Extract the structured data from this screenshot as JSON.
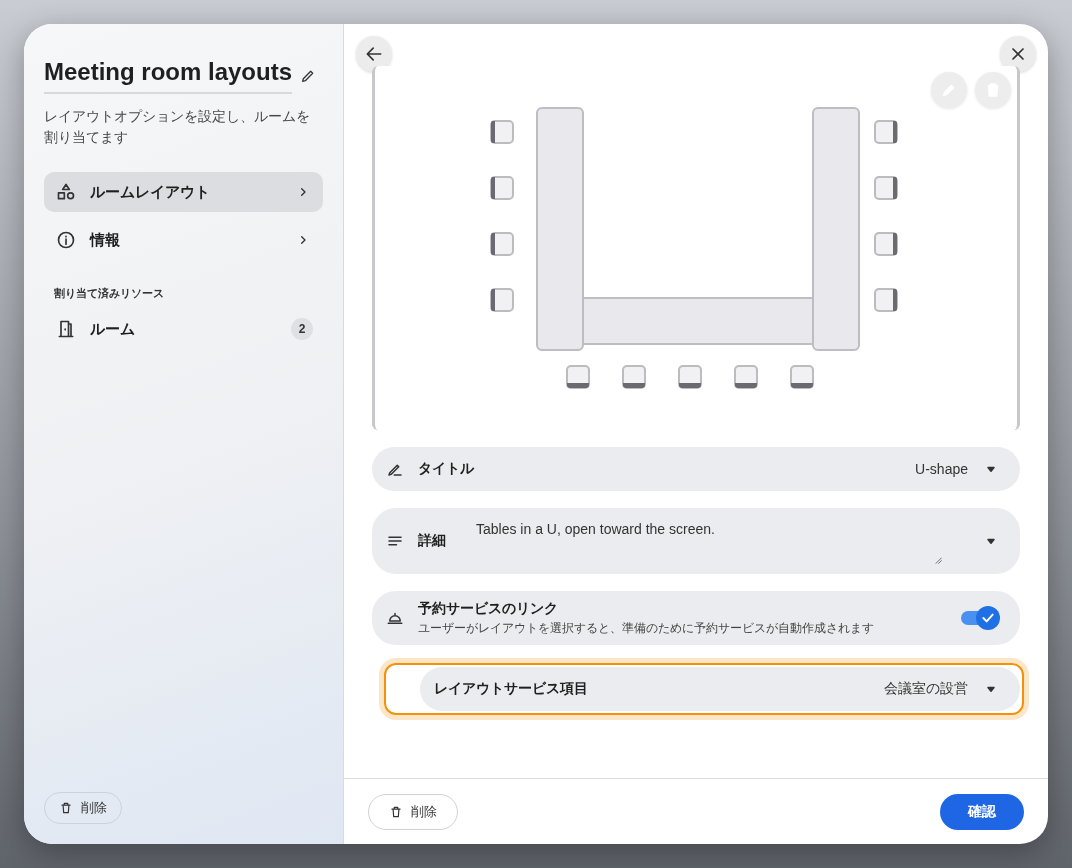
{
  "panel": {
    "title": "Meeting room layouts",
    "description": "レイアウトオプションを設定し、ルームを割り当てます",
    "nav": [
      {
        "label": "ルームレイアウト",
        "selected": true
      },
      {
        "label": "情報",
        "selected": false
      }
    ],
    "section_heading": "割り当て済みリソース",
    "resources": [
      {
        "label": "ルーム",
        "count": "2"
      }
    ],
    "delete_button": "削除"
  },
  "editor": {
    "fields": [
      {
        "kind": "select",
        "label": "タイトル",
        "value": "U-shape",
        "focused": false
      },
      {
        "kind": "textarea",
        "label": "詳細",
        "value": "Tables in a U, open toward the screen.",
        "focused": false
      },
      {
        "kind": "toggle",
        "label": "予約サービスのリンク",
        "hint": "ユーザーがレイアウトを選択すると、準備のために予約サービスが自動作成されます",
        "on": true,
        "focused": false
      },
      {
        "kind": "select",
        "label": "レイアウトサービス項目",
        "value": "会議室の設営",
        "focused": true
      }
    ]
  },
  "footer": {
    "delete_button": "削除",
    "confirm_button": "確認"
  }
}
